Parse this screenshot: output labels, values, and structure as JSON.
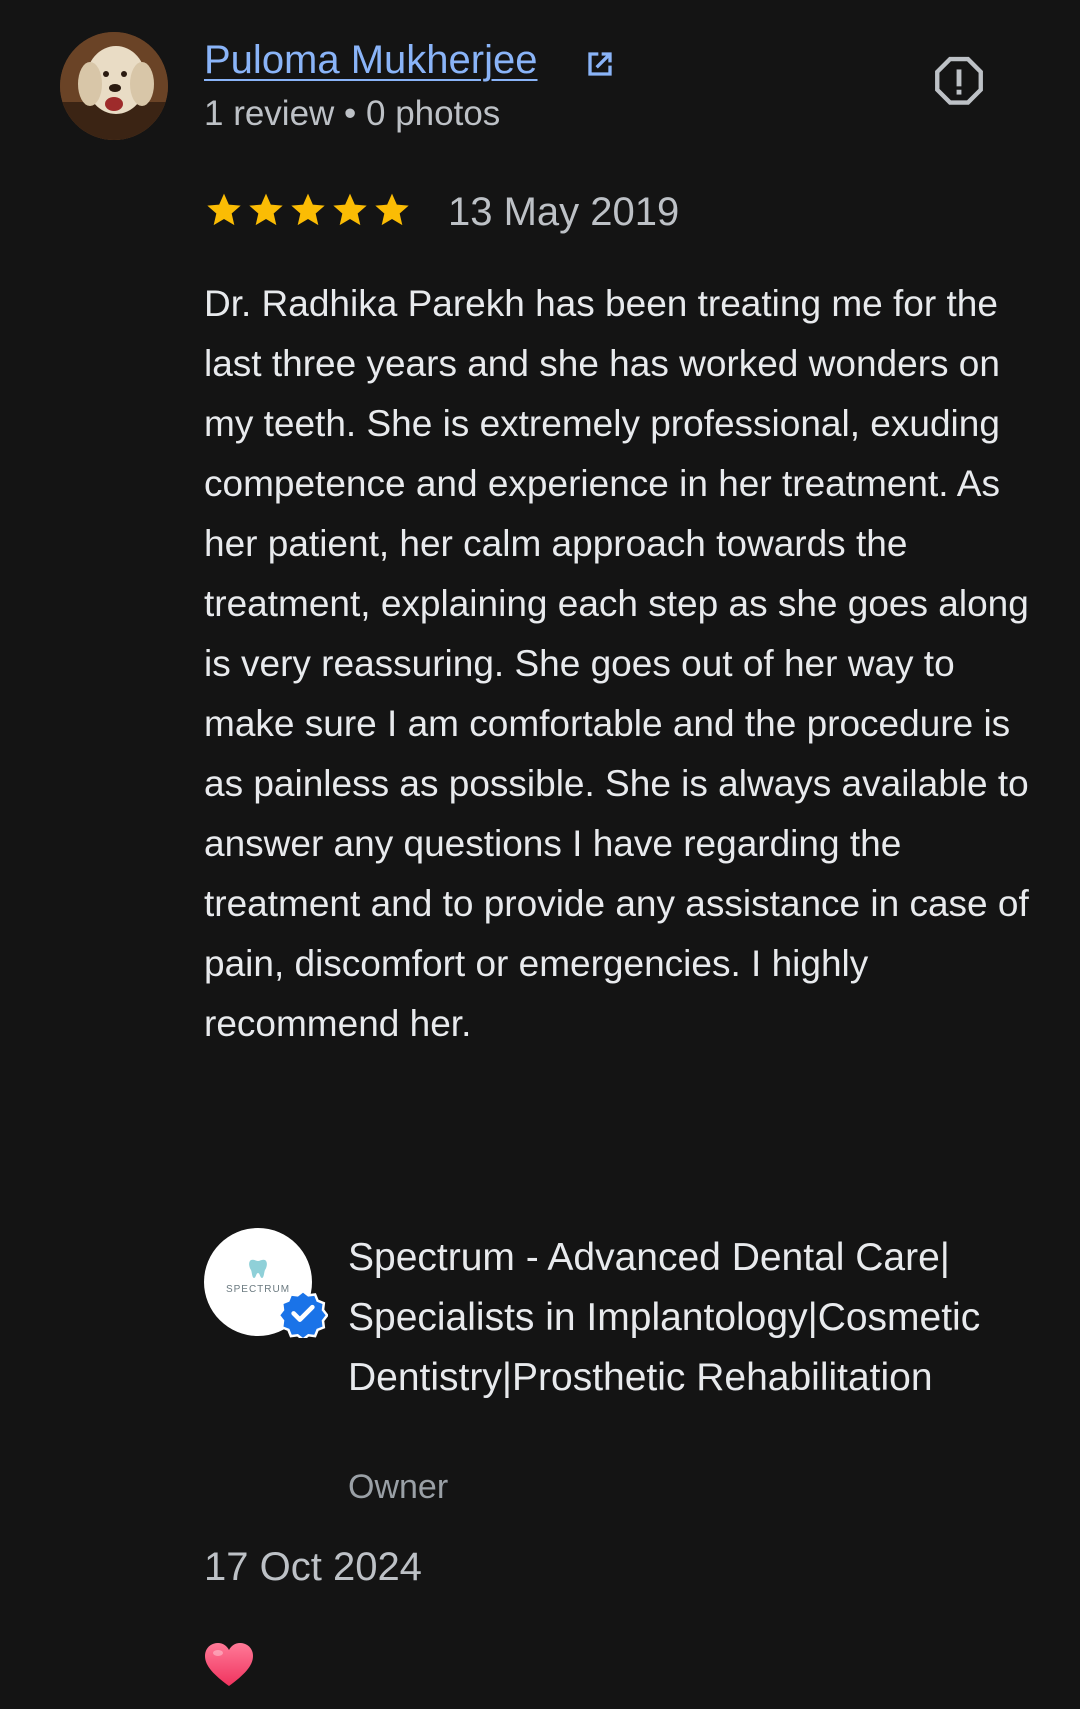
{
  "reviewer": {
    "name": "Puloma Mukherjee",
    "meta": "1 review • 0 photos"
  },
  "review": {
    "rating": 5,
    "rating_max": 5,
    "date": "13 May 2019",
    "text": "Dr. Radhika Parekh has been treating me for the last three years and she has worked wonders on my teeth. She is extremely professional, exuding competence and experience in her treatment. As her patient, her calm approach towards the treatment, explaining each step as she goes along is very reassuring. She goes out of her way to make sure I am comfortable and the procedure is as painless as possible. She is always available to answer any questions I have regarding the treatment and to provide any assistance in case of pain, discomfort or emergencies. I highly recommend her."
  },
  "owner_reply": {
    "logo_text": "SPECTRUM",
    "name": "Spectrum - Advanced Dental Care| Specialists in Implantology|Cosmetic Dentistry|Prosthetic Rehabilitation",
    "role": "Owner",
    "date": "17 Oct 2024",
    "reaction": "heart-icon"
  },
  "icons": {
    "external_link": "external-link-icon",
    "report": "report-icon",
    "star": "star-icon",
    "verified": "verified-badge-icon"
  },
  "colors": {
    "background": "#141414",
    "link": "#8ab4f8",
    "star": "#fbbc04",
    "verified": "#1a73e8",
    "heart": "#ff4f7b"
  }
}
